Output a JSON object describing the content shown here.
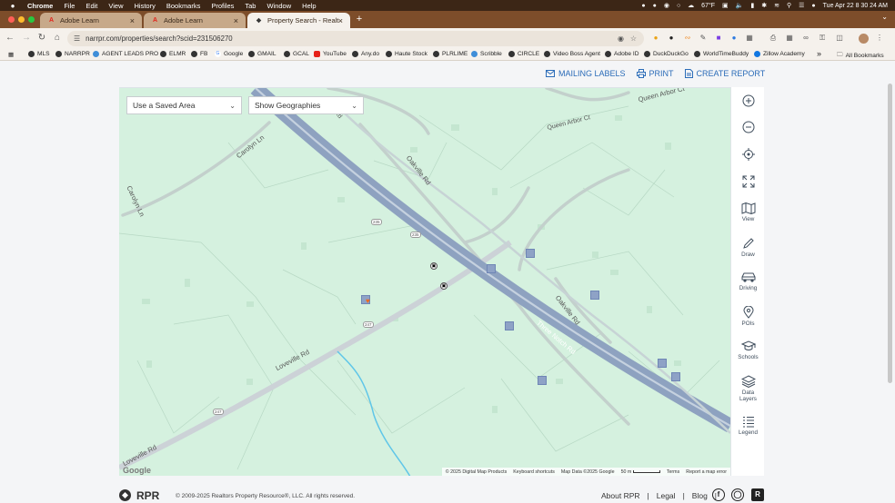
{
  "menubar": {
    "app": "Chrome",
    "items": [
      "File",
      "Edit",
      "View",
      "History",
      "Bookmarks",
      "Profiles",
      "Tab",
      "Window",
      "Help"
    ],
    "weather": "67°F",
    "datetime": "Tue Apr 22  8 30 24 AM"
  },
  "tabs": [
    {
      "title": "Adobe Learn"
    },
    {
      "title": "Adobe Learn"
    },
    {
      "title": "Property Search - Realtors P"
    }
  ],
  "url": "narrpr.com/properties/search?scid=231506270",
  "bookmarks": {
    "items": [
      "MLS",
      "NARRPR",
      "AGENT LEADS PRO",
      "ELMR",
      "FB",
      "Google",
      "GMAIL",
      "GCAL",
      "YouTube",
      "Any.do",
      "Haute Stock",
      "PLRLIME",
      "Scribble",
      "CIRCLE",
      "Video Boss Agent",
      "Adobe ID",
      "DuckDuckGo",
      "WorldTimeBuddy",
      "Zillow Academy"
    ],
    "overflow": "»",
    "all": "All Bookmarks"
  },
  "actions": {
    "mailing": "MAILING LABELS",
    "print": "PRINT",
    "report": "CREATE REPORT"
  },
  "map": {
    "saved_area": "Use a Saved Area",
    "geographies": "Show Geographies",
    "roads": {
      "queen_arbor": "Queen Arbor Ct",
      "queen_arbor_side": "Queen Arbor Ct",
      "carolyn_ln_1": "Carolyn Ln",
      "carolyn_ln_2": "Carolyn Ln",
      "oakville_rd_1": "Oakville Rd",
      "oakville_rd_2": "Oakville Rd",
      "three_notch_rd": "Three Notch Rd",
      "three_notch_rd_top": "Rd",
      "loveville_rd_1": "Loveville Rd",
      "loveville_rd_2": "Loveville Rd",
      "route_235_a": "235",
      "route_235_b": "235",
      "route_247_a": "247",
      "route_247_b": "247"
    },
    "google": "Google",
    "footer": {
      "copyright": "© 2025 Digital Map Products",
      "shortcuts": "Keyboard shortcuts",
      "mapdata": "Map Data ©2025 Google",
      "scale": "50 m",
      "terms": "Terms",
      "report": "Report a map error"
    },
    "marker_color": "#ee6a1f",
    "land_color": "#d5f1df",
    "highway_color": "#8ea2c0"
  },
  "tools": {
    "view": "View",
    "draw": "Draw",
    "driving": "Driving",
    "pois": "POIs",
    "schools": "Schools",
    "data": "Data",
    "layers": "Layers",
    "legend": "Legend"
  },
  "footer": {
    "brand": "RPR",
    "copyright": "© 2009-2025 Realtors Property Resource®, LLC. All rights reserved.",
    "about": "About RPR",
    "legal": "Legal",
    "blog": "Blog",
    "sep": "|"
  }
}
